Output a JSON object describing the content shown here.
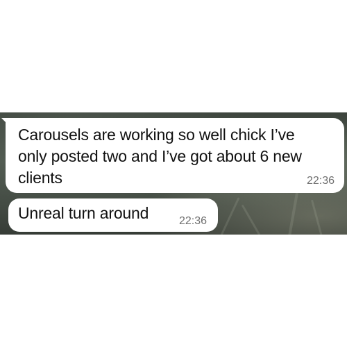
{
  "conversation": {
    "messages": [
      {
        "text": "Carousels are working so well chick I’ve only posted two and I’ve got about 6 new clients",
        "time": "22:36"
      },
      {
        "text": "Unreal turn around",
        "time": "22:36"
      }
    ]
  }
}
